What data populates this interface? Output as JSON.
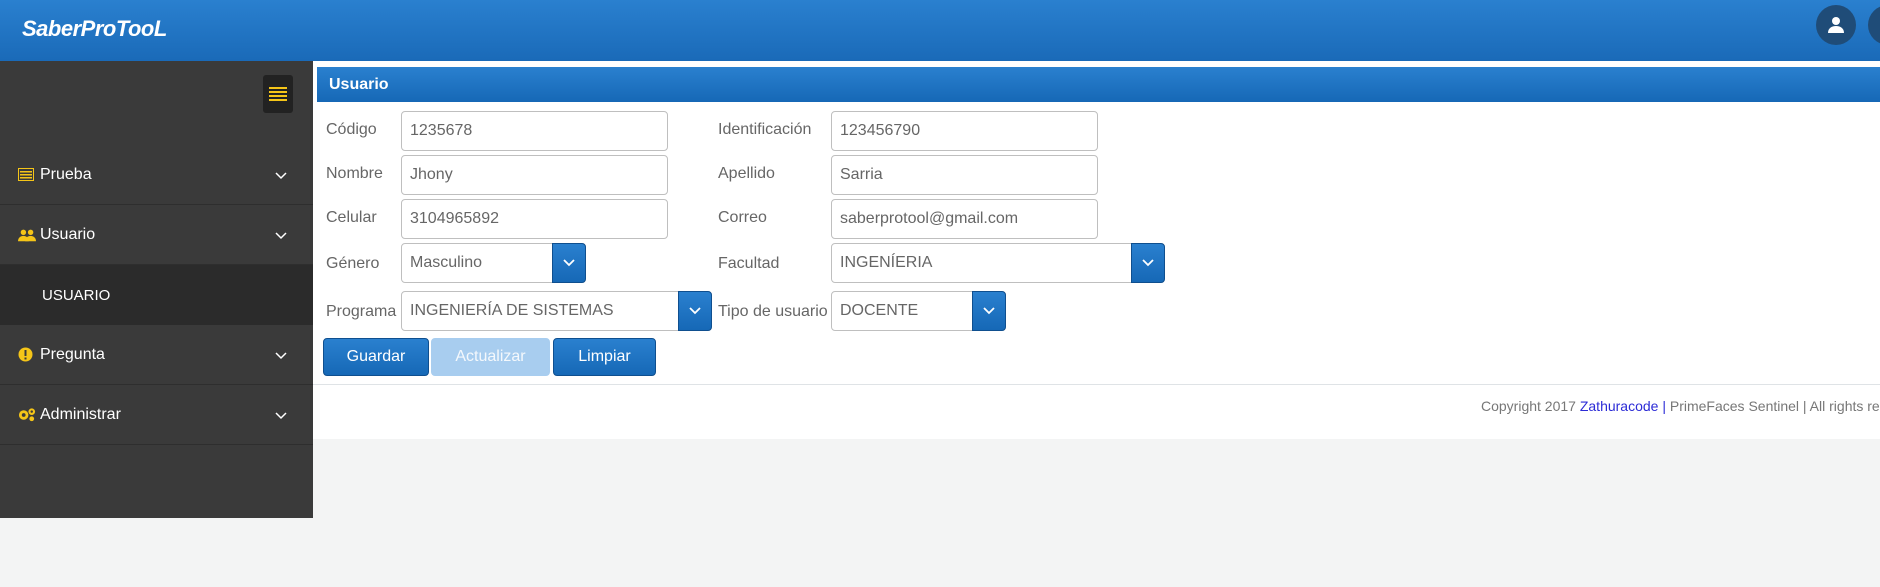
{
  "header": {
    "app_title": "SaberProTooL",
    "icons": [
      "user-icon",
      "user-icon"
    ]
  },
  "sidebar": {
    "items": [
      {
        "label": "Prueba",
        "icon": "table-icon"
      },
      {
        "label": "Usuario",
        "icon": "users-icon"
      },
      {
        "label": "USUARIO",
        "icon": ""
      },
      {
        "label": "Pregunta",
        "icon": "exclamation-icon"
      },
      {
        "label": "Administrar",
        "icon": "gears-icon"
      }
    ]
  },
  "panel": {
    "title": "Usuario"
  },
  "form": {
    "codigo": {
      "label": "Código",
      "value": "1235678"
    },
    "identificacion": {
      "label": "Identificación",
      "value": "123456790"
    },
    "nombre": {
      "label": "Nombre",
      "value": "Jhony"
    },
    "apellido": {
      "label": "Apellido",
      "value": "Sarria"
    },
    "celular": {
      "label": "Celular",
      "value": "3104965892"
    },
    "correo": {
      "label": "Correo",
      "value": "saberprotool@gmail.com"
    },
    "genero": {
      "label": "Género",
      "value": "Masculino"
    },
    "facultad": {
      "label": "Facultad",
      "value": "INGENÍERIA"
    },
    "programa": {
      "label": "Programa",
      "value": "INGENIERÍA DE SISTEMAS"
    },
    "tipo_usuario": {
      "label": "Tipo de usuario",
      "value": "DOCENTE"
    }
  },
  "actions": {
    "guardar": "Guardar",
    "actualizar": "Actualizar",
    "limpiar": "Limpiar"
  },
  "footer": {
    "copyright": "Copyright 2017 ",
    "link": "Zathuracode",
    "sep": " | ",
    "rest": "PrimeFaces Sentinel | All rights reserved"
  },
  "colors": {
    "primary": "#1a6ab8",
    "sidebar_bg": "#3a3a3a",
    "icon_accent": "#f5c518",
    "disabled": "#a8cdef",
    "footer_link": "#2c2bd6"
  }
}
